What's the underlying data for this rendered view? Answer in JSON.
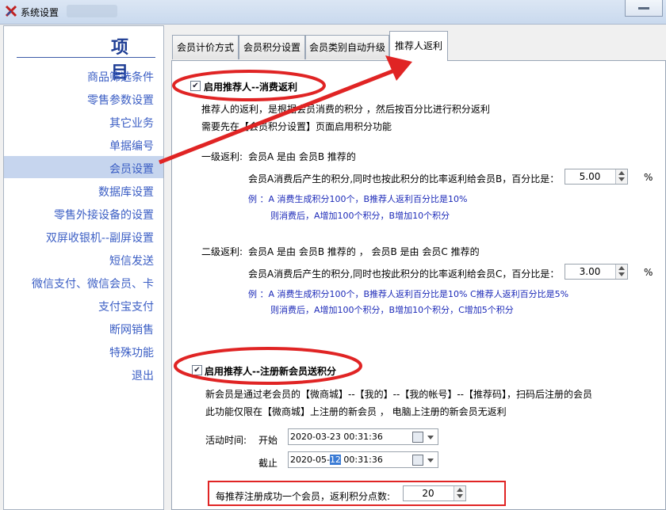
{
  "window": {
    "title": "系统设置"
  },
  "sidebar": {
    "header": "项目",
    "items": [
      {
        "label": "商品筛选条件"
      },
      {
        "label": "零售参数设置"
      },
      {
        "label": "其它业务"
      },
      {
        "label": "单据编号"
      },
      {
        "label": "会员设置"
      },
      {
        "label": "数据库设置"
      },
      {
        "label": "零售外接设备的设置"
      },
      {
        "label": "双屏收银机--副屏设置"
      },
      {
        "label": "短信发送"
      },
      {
        "label": "微信支付、微信会员、卡"
      },
      {
        "label": "支付宝支付"
      },
      {
        "label": "断网销售"
      },
      {
        "label": "特殊功能"
      },
      {
        "label": "退出"
      }
    ],
    "active_index": 4
  },
  "tabs": [
    {
      "label": "会员计价方式"
    },
    {
      "label": "会员积分设置"
    },
    {
      "label": "会员类别自动升级"
    },
    {
      "label": "推荐人返利"
    }
  ],
  "rebate": {
    "enable_label": "启用推荐人--消费返利",
    "enabled": true,
    "desc1": "推荐人的返利，是根据会员消费的积分 ，然后按百分比进行积分返利",
    "desc2": "需要先在【会员积分设置】页面启用积分功能",
    "level1": {
      "title": "一级返利:",
      "relation": "会员A   是由 会员B 推荐的",
      "line": "会员A消费后产生的积分,同时也按此积分的比率返利给会员B，百分比是：",
      "value": "5.00",
      "unit": "%",
      "ex1": "例 ：A 消费生成积分100个，B推荐人返利百分比是10%",
      "ex2": "则消费后，A增加100个积分，B增加10个积分"
    },
    "level2": {
      "title": "二级返利:",
      "relation": "会员A   是由 会员B 推荐的 ， 会员B  是由 会员C 推荐的",
      "line": "会员A消费后产生的积分,同时也按此积分的比率返利给会员C，百分比是：",
      "value": "3.00",
      "unit": "%",
      "ex1": "例 ：A 消费生成积分100个，B推荐人返利百分比是10% C推荐人返利百分比是5%",
      "ex2": "则消费后，A增加100个积分，B增加10个积分，C增加5个积分"
    }
  },
  "register": {
    "enable_label": "启用推荐人--注册新会员送积分",
    "enabled": true,
    "desc1": "新会员是通过老会员的【微商城】--【我的】--【我的帐号】--【推荐码】，扫码后注册的会员",
    "desc2": "此功能仅限在【微商城】上注册的新会员 ， 电脑上注册的新会员无返利",
    "period_label": "活动时间:",
    "start_label": "开始",
    "start_value": "2020-03-23 00:31:36",
    "end_label": "截止",
    "end_value_pre": "2020-05-",
    "end_value_sel": "12",
    "end_value_post": " 00:31:36",
    "points_label": "每推荐注册成功一个会员，返利积分点数:",
    "points_value": "20"
  },
  "colors": {
    "annotation": "#e02424",
    "link": "#3b5ec4",
    "example_text": "#1c2ab8",
    "header": "#1e3d94"
  }
}
